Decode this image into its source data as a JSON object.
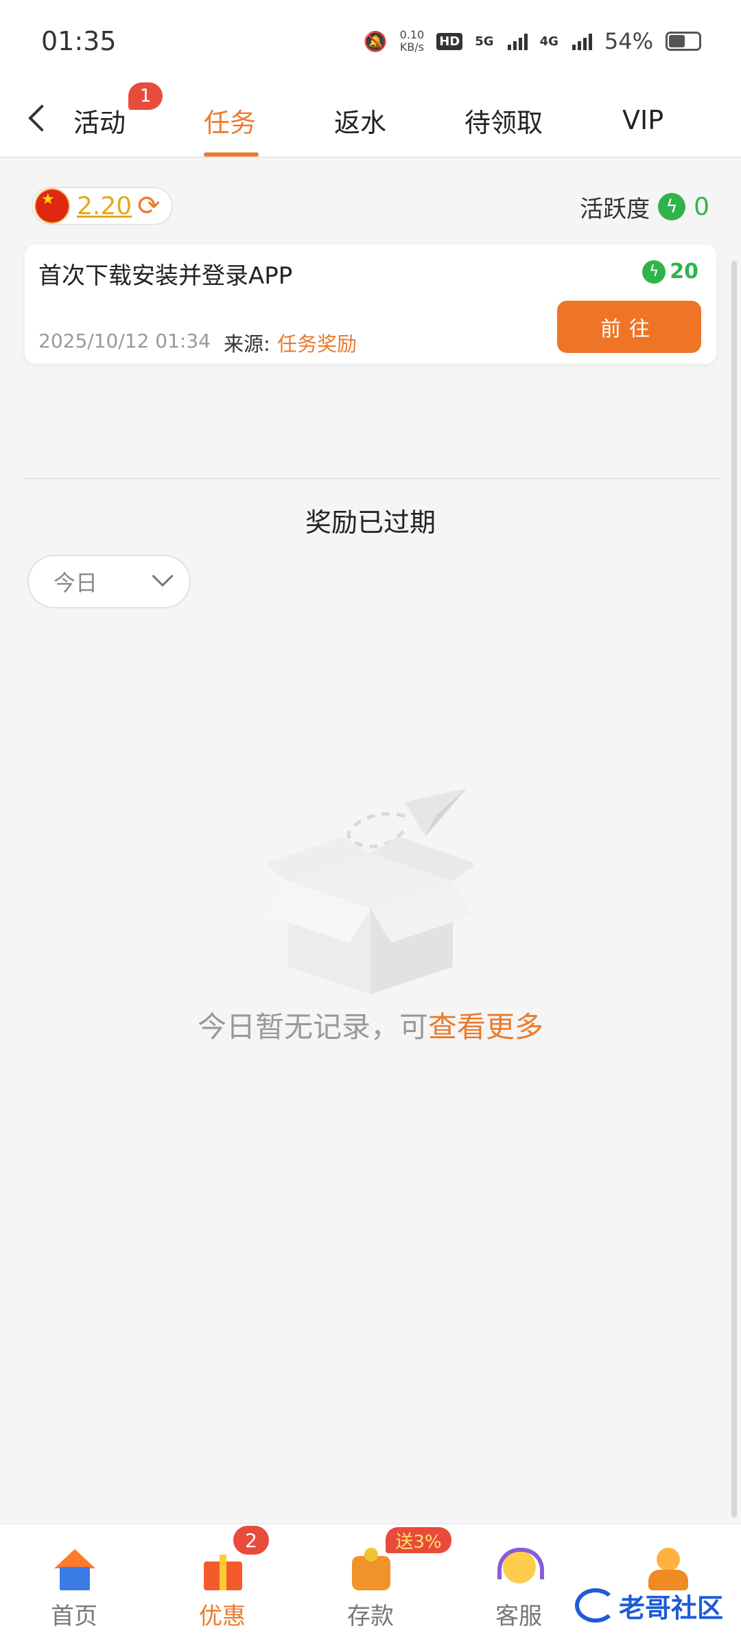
{
  "status_bar": {
    "time": "01:35",
    "net_speed_value": "0.10",
    "net_speed_unit": "KB/s",
    "hd_badge": "HD",
    "sim1_network": "5G",
    "sim2_network": "4G",
    "battery_percent": "54%",
    "battery_level": 0.54
  },
  "top_tabs": {
    "tabs": [
      {
        "label": "活动"
      },
      {
        "label": "任务"
      },
      {
        "label": "返水"
      },
      {
        "label": "待领取"
      },
      {
        "label": "VIP"
      }
    ],
    "active_tab": "任务",
    "activity_badge": "1"
  },
  "balance": {
    "amount": "2.20",
    "flag_icon": "china-flag-icon",
    "refresh_icon": "refresh-icon"
  },
  "activity": {
    "label": "活跃度",
    "value": "0"
  },
  "task": {
    "title": "首次下载安装并登录APP",
    "reward": "20",
    "date": "2025/10/12 01:34",
    "source_label": "来源:",
    "source_value": "任务奖励",
    "button_label": "前往"
  },
  "section": {
    "expired_title": "奖励已过期"
  },
  "filter": {
    "selected": "今日"
  },
  "empty_state": {
    "text": "今日暂无记录，可",
    "link": "查看更多"
  },
  "bottom_nav": {
    "items": [
      {
        "label": "首页",
        "icon": "home-icon"
      },
      {
        "label": "优惠",
        "icon": "gift-icon"
      },
      {
        "label": "存款",
        "icon": "wallet-icon"
      },
      {
        "label": "客服",
        "icon": "customer-service-icon"
      },
      {
        "label": "",
        "icon": "profile-icon"
      }
    ],
    "active": "优惠",
    "promo_badge": "2",
    "deposit_badge": "送3%"
  },
  "watermark": {
    "text": "老哥社区"
  },
  "colors": {
    "accent": "#ea7a2c",
    "button": "#ef7426",
    "green": "#2fb34a",
    "gold": "#e6a817",
    "badge_red": "#e84b3c"
  }
}
